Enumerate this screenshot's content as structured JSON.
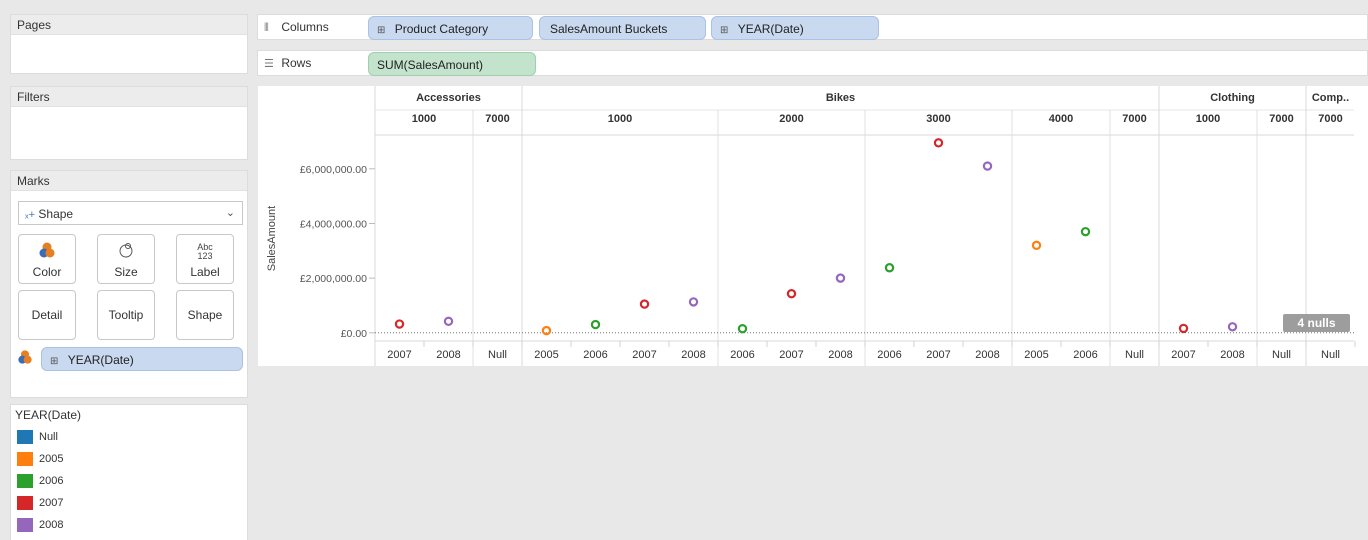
{
  "left": {
    "pages": {
      "title": "Pages"
    },
    "filters": {
      "title": "Filters"
    },
    "marks": {
      "title": "Marks",
      "mark_type": "Shape",
      "buttons": [
        {
          "label": "Color",
          "icon": "color-icon",
          "glyph": "●"
        },
        {
          "label": "Size",
          "icon": "size-icon",
          "glyph": "◔"
        },
        {
          "label": "Label",
          "icon": "label-icon",
          "glyph": "Abc"
        },
        {
          "label": "Detail",
          "icon": ""
        },
        {
          "label": "Tooltip",
          "icon": ""
        },
        {
          "label": "Shape",
          "icon": ""
        }
      ],
      "encoding_pill": "YEAR(Date)"
    },
    "legend": {
      "title": "YEAR(Date)",
      "items": [
        {
          "label": "Null",
          "color": "#1f77b4"
        },
        {
          "label": "2005",
          "color": "#ff7f0e"
        },
        {
          "label": "2006",
          "color": "#2ca02c"
        },
        {
          "label": "2007",
          "color": "#d62728"
        },
        {
          "label": "2008",
          "color": "#9467bd"
        }
      ]
    }
  },
  "shelves": {
    "columns": {
      "label": "Columns",
      "pills": [
        "Product Category",
        "SalesAmount Buckets",
        "YEAR(Date)"
      ]
    },
    "rows": {
      "label": "Rows",
      "pills": [
        "SUM(SalesAmount)"
      ]
    }
  },
  "chart_data": {
    "type": "scatter",
    "ylabel": "SalesAmount",
    "ylim": [
      -300000,
      7200000
    ],
    "yticks": [
      {
        "value": 0,
        "label": "£0.00"
      },
      {
        "value": 2000000,
        "label": "£2,000,000.00"
      },
      {
        "value": 4000000,
        "label": "£4,000,000.00"
      },
      {
        "value": 6000000,
        "label": "£6,000,000.00"
      }
    ],
    "null_badge": "4 nulls",
    "categories": [
      {
        "name": "Accessories",
        "buckets": [
          {
            "name": "1000",
            "years": [
              {
                "year": "2007",
                "value": 320000
              },
              {
                "year": "2008",
                "value": 420000
              }
            ]
          },
          {
            "name": "7000",
            "years": [
              {
                "year": "Null",
                "value": null
              }
            ]
          }
        ]
      },
      {
        "name": "Bikes",
        "buckets": [
          {
            "name": "1000",
            "years": [
              {
                "year": "2005",
                "value": 80000
              },
              {
                "year": "2006",
                "value": 300000
              },
              {
                "year": "2007",
                "value": 1050000
              },
              {
                "year": "2008",
                "value": 1130000
              }
            ]
          },
          {
            "name": "2000",
            "years": [
              {
                "year": "2006",
                "value": 150000
              },
              {
                "year": "2007",
                "value": 1430000
              },
              {
                "year": "2008",
                "value": 2000000
              }
            ]
          },
          {
            "name": "3000",
            "years": [
              {
                "year": "2006",
                "value": 2380000
              },
              {
                "year": "2007",
                "value": 6950000
              },
              {
                "year": "2008",
                "value": 6100000
              }
            ]
          },
          {
            "name": "4000",
            "years": [
              {
                "year": "2005",
                "value": 3200000
              },
              {
                "year": "2006",
                "value": 3700000
              }
            ]
          },
          {
            "name": "7000",
            "years": [
              {
                "year": "Null",
                "value": null
              }
            ]
          }
        ]
      },
      {
        "name": "Clothing",
        "buckets": [
          {
            "name": "1000",
            "years": [
              {
                "year": "2007",
                "value": 160000
              },
              {
                "year": "2008",
                "value": 220000
              }
            ]
          },
          {
            "name": "7000",
            "years": [
              {
                "year": "Null",
                "value": null
              }
            ]
          }
        ]
      },
      {
        "name": "Comp..",
        "buckets": [
          {
            "name": "7000",
            "years": [
              {
                "year": "Null",
                "value": null
              }
            ]
          }
        ]
      }
    ],
    "year_colors": {
      "Null": "#1f77b4",
      "2005": "#ff7f0e",
      "2006": "#2ca02c",
      "2007": "#d62728",
      "2008": "#9467bd"
    }
  }
}
